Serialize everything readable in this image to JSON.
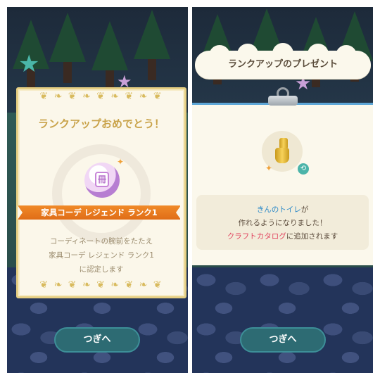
{
  "left": {
    "title": "ランクアップおめでとう！",
    "medal_glyph": "冊",
    "rank_label": "家具コーデ レジェンド ランク1",
    "description_lines": [
      "コーディネートの腕前をたたえ",
      "家具コーデ レジェンド ランク1",
      "に認定します"
    ],
    "next_button": "つぎへ"
  },
  "right": {
    "title": "ランクアップのプレゼント",
    "item_name": "きんのトイレ",
    "line1_suffix": "が",
    "line2": "作れるようになりました！",
    "catalog_name": "クラフトカタログ",
    "line3_suffix": "に追加されます",
    "next_button": "つぎへ"
  },
  "colors": {
    "title_gold": "#c9a34a",
    "rank_orange": "#f08a28",
    "button_teal": "#2d6b73",
    "item_blue": "#2c8ac9",
    "catalog_pink": "#e1445f"
  },
  "icons": {
    "medal": "furniture-medal-icon",
    "item": "golden-toilet-icon",
    "badge": "link-icon"
  }
}
